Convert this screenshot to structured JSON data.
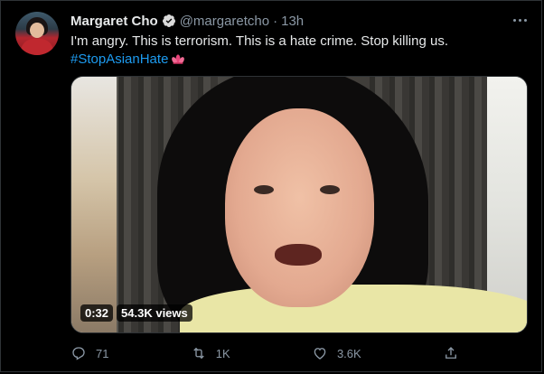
{
  "tweet": {
    "author_name": "Margaret Cho",
    "handle": "@margaretcho",
    "separator": "·",
    "time": "13h",
    "text": "I'm angry. This is terrorism. This is a hate crime. Stop killing us.",
    "hashtag": "#StopAsianHate",
    "verified": true,
    "hashtag_emoji": "lotus"
  },
  "media": {
    "duration": "0:32",
    "views": "54.3K views"
  },
  "actions": {
    "reply_count": "71",
    "retweet_count": "1K",
    "like_count": "3.6K"
  },
  "colors": {
    "background": "#000000",
    "accent": "#1d9bf0",
    "muted": "#8b98a5",
    "text": "#e7e9ea"
  },
  "icons": [
    "verified-badge-icon",
    "more-icon",
    "reply-icon",
    "retweet-icon",
    "like-icon",
    "share-icon",
    "lotus-icon"
  ]
}
